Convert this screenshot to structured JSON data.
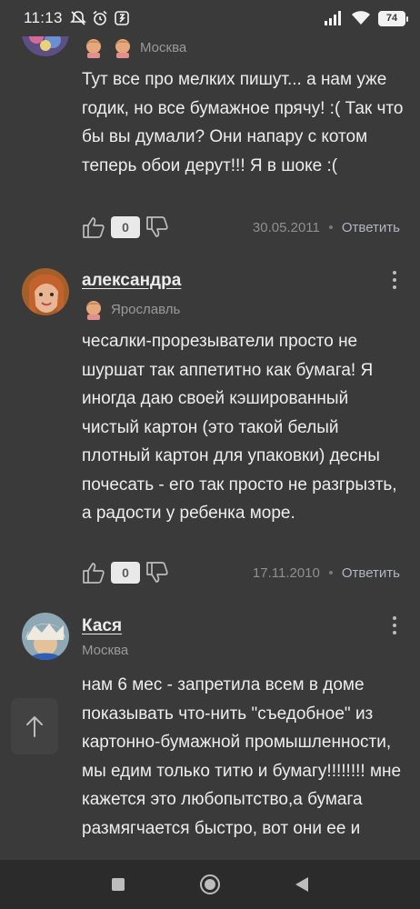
{
  "status_bar": {
    "time": "11:13",
    "battery": "74"
  },
  "comments": [
    {
      "author": "",
      "city": "Москва",
      "text": "Тут все про мелких пишут... а нам уже годик, но все бумажное прячу! :( Так что бы вы думали? Они напару с котом теперь обои дерут!!! Я в шоке :(",
      "likes": "0",
      "date": "30.05.2011",
      "reply_label": "Ответить"
    },
    {
      "author": "александра",
      "city": "Ярославль",
      "text": "чесалки-прорезыватели просто не шуршат так аппетитно как бумага! Я иногда даю своей кэшированный чистый картон (это такой белый плотный картон для упаковки) десны почесать - его так просто не разгрызть, а радости у ребенка море.",
      "likes": "0",
      "date": "17.11.2010",
      "reply_label": "Ответить"
    },
    {
      "author": "Кася",
      "city": "Москва",
      "text": "нам 6 мес - запретила всем в доме показывать что-нить \"съедобное\" из картонно-бумажной промышленности, мы едим только титю и бумагу!!!!!!!! мне кажется это любопытство,а  бумага размягчается быстро, вот они ее и"
    }
  ],
  "icons": {
    "status": [
      "mute-icon",
      "alarm-icon",
      "app-icon",
      "signal-icon",
      "wifi-icon",
      "battery-icon"
    ],
    "nav": [
      "recent-apps-icon",
      "home-icon",
      "back-icon"
    ],
    "fab": "arrow-up-icon"
  },
  "colors": {
    "background": "#3a3a3a",
    "text": "#ededed",
    "muted": "#9a9a9a",
    "reply": "#b0b6c0",
    "nav_bar": "#2b2b2b"
  }
}
